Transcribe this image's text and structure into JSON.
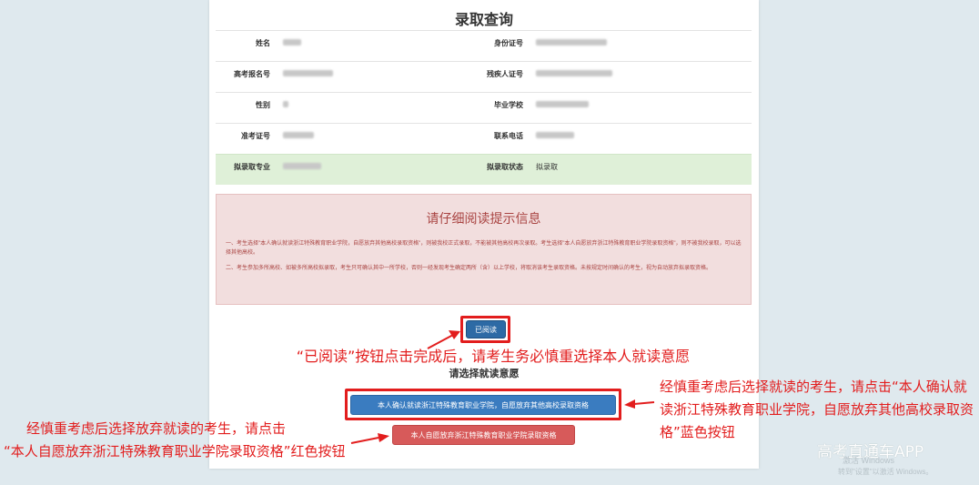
{
  "page": {
    "title": "录取查询"
  },
  "info": {
    "rows": [
      {
        "label1": "姓名",
        "label2": "身份证号"
      },
      {
        "label1": "高考报名号",
        "label2": "残疾人证号"
      },
      {
        "label1": "性别",
        "label2": "毕业学校"
      },
      {
        "label1": "准考证号",
        "label2": "联系电话"
      },
      {
        "label1": "拟录取专业",
        "label2": "拟录取状态",
        "value2": "拟录取"
      }
    ]
  },
  "notice": {
    "title": "请仔细阅读提示信息",
    "p1": "一、考生选择\"本人确认就读浙江特殊教育职业学院，自愿放弃其他高校录取资格\"，则被我校正式录取，不能被其他高校再次录取。考生选择\"本人自愿放弃浙江特殊教育职业学院录取资格\"，则不被我校录取，可以选择其他高校。",
    "p2": "二、考生参加多所高校、如被多所高校拟录取，考生只可确认其中一所学校，否则一经发现考生确定两所（含）以上学校，将取消该考生录取资格。未按规定时间确认的考生，视为自动放弃拟录取资格。"
  },
  "buttons": {
    "read": "已阅读",
    "confirm": "本人确认就读浙江特殊教育职业学院，自愿放弃其他高校录取资格",
    "giveup": "本人自愿放弃浙江特殊教育职业学院录取资格"
  },
  "choose_title": "请选择就读意愿",
  "annotations": {
    "center": "“已阅读”按钮点击完成后，请考生务必慎重选择本人就读意愿",
    "right": "经慎重考虑后选择就读的考生，请点击“本人确认就读浙江特殊教育职业学院，自愿放弃其他高校录取资格”蓝色按钮",
    "left_line1": "经慎重考虑后选择放弃就读的考生，请点击",
    "left_line2": "“本人自愿放弃浙江特殊教育职业学院录取资格”红色按钮"
  },
  "watermark": "高考直通车APP",
  "windows_activation": {
    "line1": "激活 Windows",
    "line2": "转到\"设置\"以激活 Windows。"
  },
  "colors": {
    "annotation_red": "#e21d1d",
    "confirm_blue": "#3a7cc0",
    "giveup_red": "#d75a5a",
    "notice_bg": "#f2dede",
    "admitted_bg": "#dff0d8"
  }
}
